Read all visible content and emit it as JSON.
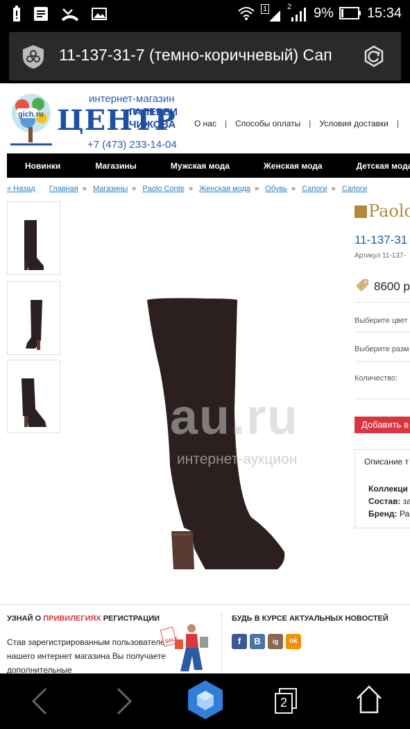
{
  "status_bar": {
    "sim1": "1",
    "sim2": "2",
    "battery": "9%",
    "time": "15:34"
  },
  "browser": {
    "page_title": "11-137-31-7 (темно-коричневый) Сап",
    "tab_count": "2"
  },
  "site": {
    "logo_top": "интернет-магазин",
    "logo_main": "ЦЕНТР",
    "logo_sub1": "ГАЛЕРЕИ",
    "logo_sub2": "ЧИЖОВА",
    "logo_badge": "gich.ru",
    "phone": "+7 (473) 233-14-04",
    "top_links": [
      "О нас",
      "Способы оплаты",
      "Условия доставки"
    ],
    "menu": [
      "Новинки",
      "Магазины",
      "Мужская мода",
      "Женская мода",
      "Детская мода"
    ]
  },
  "breadcrumbs": {
    "back": "« Назад",
    "items": [
      "Главная",
      "Магазины",
      "Paolo Conte",
      "Женская мода",
      "Обувь",
      "Сапоги",
      "Сапоги"
    ],
    "separator": "»"
  },
  "product": {
    "brand_logo": "Paolo",
    "title": "11-137-31",
    "sku": "Артикул 11-137-",
    "price": "8600 р",
    "choose_color": "Выберите цвет",
    "choose_size": "Выберите разм",
    "quantity_label": "Количество:",
    "add_button": "Добавить в",
    "description_title": "Описание т",
    "desc_lines": [
      {
        "label": "Коллекци",
        "value": ""
      },
      {
        "label": "Состав:",
        "value": "за"
      },
      {
        "label": "Бренд:",
        "value": "Ра"
      }
    ],
    "watermark": "au.ru",
    "watermark_sub": "интернет-аукцион"
  },
  "footer": {
    "reg_head_1": "УЗНАЙ О ",
    "reg_head_red": "ПРИВИЛЕГИЯХ",
    "reg_head_2": " РЕГИСТРАЦИИ",
    "reg_text": "Став зарегистрированным пользователем нашего интернет магазина Вы получаете дополнительные",
    "news_head": "БУДЬ В КУРСЕ АКТУАЛЬНЫХ НОВОСТЕЙ",
    "sale_tag": "SALE",
    "social": [
      "f",
      "B",
      "ig",
      "ok"
    ]
  },
  "colors": {
    "accent_red": "#d9363e",
    "link_blue": "#2a7fb8",
    "brand_blue": "#1e4fa3",
    "boot": "#2b1f1f",
    "heel": "#5a3a30"
  }
}
